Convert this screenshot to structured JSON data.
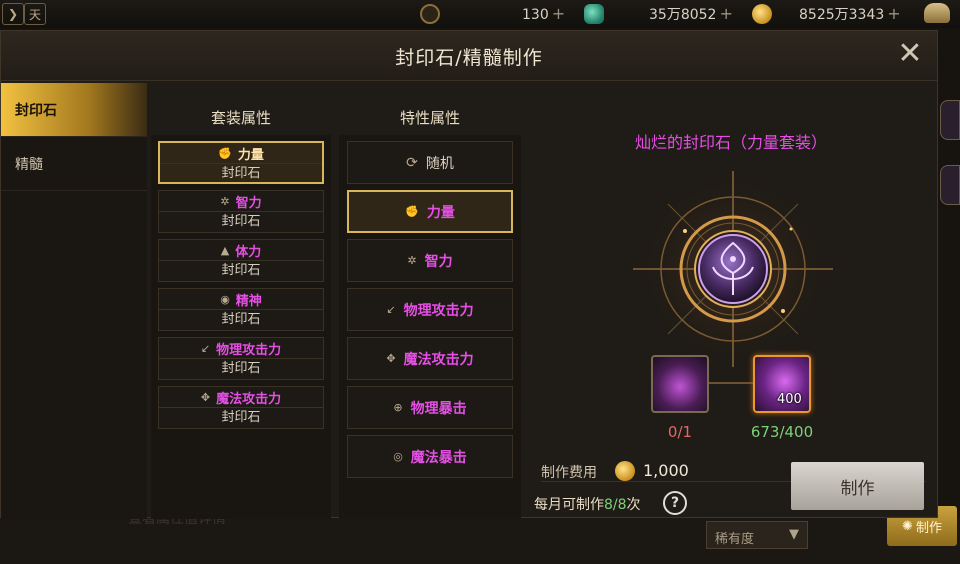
{
  "topbar": {
    "resources": [
      {
        "icon": "c-coin-icon",
        "value": "130"
      },
      {
        "icon": "green-gem-icon",
        "value": "35万8052"
      },
      {
        "icon": "gold-coin-icon",
        "value": "8525万3343"
      }
    ],
    "plus": "+",
    "calendar_glyph": "天"
  },
  "dialog": {
    "title": "封印石/精髓制作",
    "close_glyph": "✕"
  },
  "tabs": [
    {
      "label": "封印石",
      "active": true
    },
    {
      "label": "精髓",
      "active": false
    }
  ],
  "set_attributes": {
    "header": "套装属性",
    "items": [
      {
        "name": "力量",
        "sub": "封印石",
        "icon": "fist-icon",
        "selected": true
      },
      {
        "name": "智力",
        "sub": "封印石",
        "icon": "star-burst-icon",
        "selected": false
      },
      {
        "name": "体力",
        "sub": "封印石",
        "icon": "mountain-icon",
        "selected": false
      },
      {
        "name": "精神",
        "sub": "封印石",
        "icon": "eye-icon",
        "selected": false
      },
      {
        "name": "物理攻击力",
        "sub": "封印石",
        "icon": "sword-icon",
        "selected": false
      },
      {
        "name": "魔法攻击力",
        "sub": "封印石",
        "icon": "magic-burst-icon",
        "selected": false
      }
    ]
  },
  "traits": {
    "header": "特性属性",
    "items": [
      {
        "name": "随机",
        "icon": "refresh-icon",
        "selected": false
      },
      {
        "name": "力量",
        "icon": "fist-icon",
        "selected": true
      },
      {
        "name": "智力",
        "icon": "star-burst-icon",
        "selected": false
      },
      {
        "name": "物理攻击力",
        "icon": "sword-icon",
        "selected": false
      },
      {
        "name": "魔法攻击力",
        "icon": "magic-burst-icon",
        "selected": false
      },
      {
        "name": "物理暴击",
        "icon": "crosshair-icon",
        "selected": false
      },
      {
        "name": "魔法暴击",
        "icon": "target-icon",
        "selected": false
      }
    ]
  },
  "craft": {
    "result_name": "灿烂的封印石（力量套装）",
    "result_icon": "seal-stone-icon",
    "materials": [
      {
        "icon": "purple-bowl-icon",
        "count": "0/1"
      },
      {
        "icon": "purple-essence-icon",
        "qty": "400",
        "count": "673/400"
      }
    ],
    "cost_label": "制作费用",
    "cost_value": "1,000",
    "monthly_prefix": "每月可制作",
    "monthly_count": "8/8",
    "monthly_suffix": "次",
    "help_glyph": "?",
    "button_label": "制作"
  },
  "background": {
    "rarity_label": "稀有度",
    "craft_label": "制作",
    "ghost_text": "查看属性值详情"
  },
  "colors": {
    "accent_gold": "#d8b65a",
    "epic_magenta": "#e44fe4",
    "ok_green": "#7ed07a",
    "warn_red": "#e06a6a"
  }
}
